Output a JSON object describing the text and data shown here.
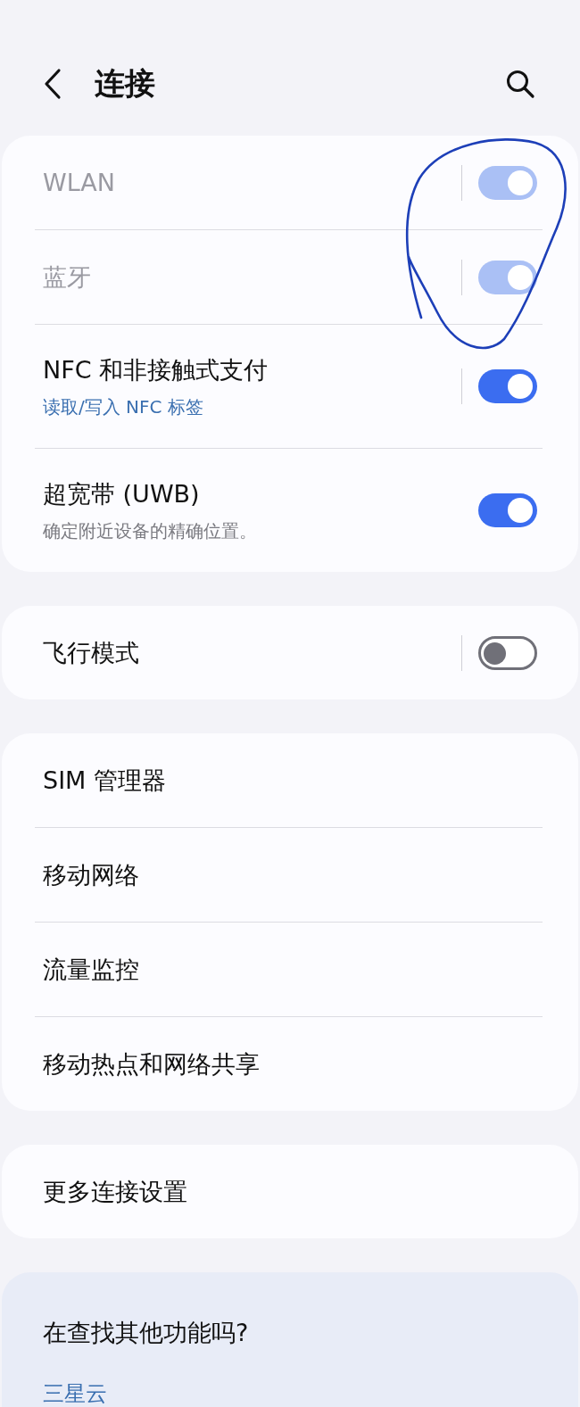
{
  "header": {
    "title": "连接"
  },
  "groups": [
    {
      "rows": [
        {
          "kind": "toggle",
          "label": "WLAN",
          "on": true,
          "disabled": true,
          "separator": true
        },
        {
          "kind": "toggle",
          "label": "蓝牙",
          "on": true,
          "disabled": true,
          "separator": true
        },
        {
          "kind": "toggle",
          "label": "NFC 和非接触式支付",
          "subtitle": {
            "kind": "link",
            "text": "读取/写入 NFC 标签"
          },
          "on": true,
          "disabled": false,
          "separator": true
        },
        {
          "kind": "toggle",
          "label": "超宽带 (UWB)",
          "subtitle": {
            "kind": "note",
            "text": "确定附近设备的精确位置。"
          },
          "on": true,
          "disabled": false,
          "separator": false
        }
      ]
    },
    {
      "rows": [
        {
          "kind": "toggle",
          "label": "飞行模式",
          "on": false,
          "disabled": false,
          "separator": true
        }
      ]
    },
    {
      "rows": [
        {
          "kind": "link",
          "label": "SIM 管理器"
        },
        {
          "kind": "link",
          "label": "移动网络"
        },
        {
          "kind": "link",
          "label": "流量监控"
        },
        {
          "kind": "link",
          "label": "移动热点和网络共享"
        }
      ]
    },
    {
      "rows": [
        {
          "kind": "link",
          "label": "更多连接设置"
        }
      ]
    }
  ],
  "suggest": {
    "title": "在查找其他功能吗?",
    "link": "三星云"
  }
}
